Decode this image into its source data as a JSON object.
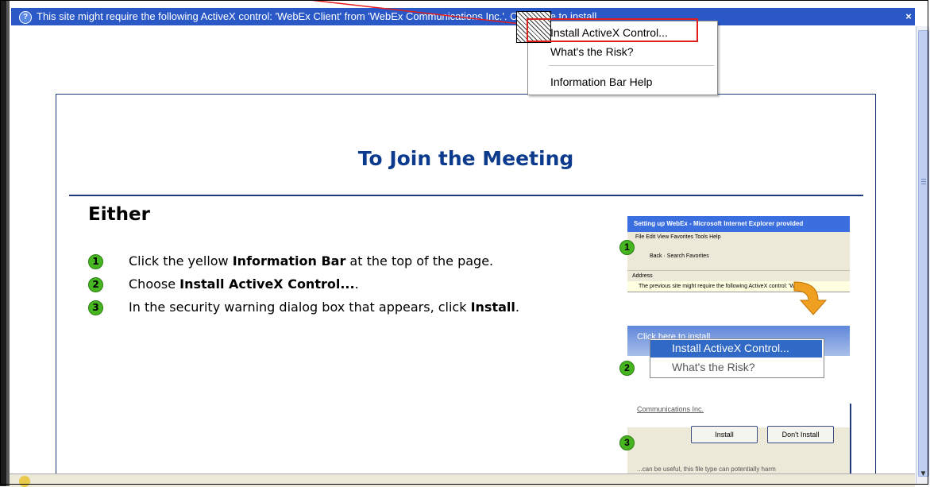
{
  "info_bar": {
    "text": "This site might require the following ActiveX control: 'WebEx Client' from 'WebEx Communications Inc.'. Click here to install..."
  },
  "context_menu": {
    "items": [
      {
        "label": "Install ActiveX Control..."
      },
      {
        "label": "What's the Risk?"
      },
      {
        "label": "Information Bar Help"
      }
    ]
  },
  "page": {
    "title": "To Join the Meeting",
    "either": "Either",
    "steps": [
      {
        "number": "1",
        "prefix": "Click the yellow ",
        "bold": "Information Bar",
        "suffix": " at the top of the page."
      },
      {
        "number": "2",
        "prefix": "Choose ",
        "bold": "Install ActiveX Control...",
        "suffix": "."
      },
      {
        "number": "3",
        "prefix": "In the security warning dialog box that appears, click ",
        "bold": "Install",
        "suffix": "."
      }
    ]
  },
  "illustration": {
    "window_title": "Setting up WebEx - Microsoft Internet Explorer provided",
    "menu": "File  Edit  View  Favorites  Tools  Help",
    "toolbar": "Back  ·  Search  Favorites",
    "address_label": "Address",
    "info_text": "The previous site might require the following ActiveX control: 'WebEx",
    "band_text": "Click here to install...",
    "popup_item_1": "Install ActiveX Control...",
    "popup_item_2": "What's the Risk?",
    "dialog_text": "Communications Inc.",
    "install_button": "Install",
    "dont_install_button": "Don't Install",
    "footer_text": "...can be useful, this file type can potentially harm",
    "step_numbers": [
      "1",
      "2",
      "3"
    ]
  },
  "colors": {
    "info_bar": "#2b58c7",
    "title": "#0c3a8c",
    "step_badge": "#45b520",
    "highlight": "#e21f1f"
  }
}
